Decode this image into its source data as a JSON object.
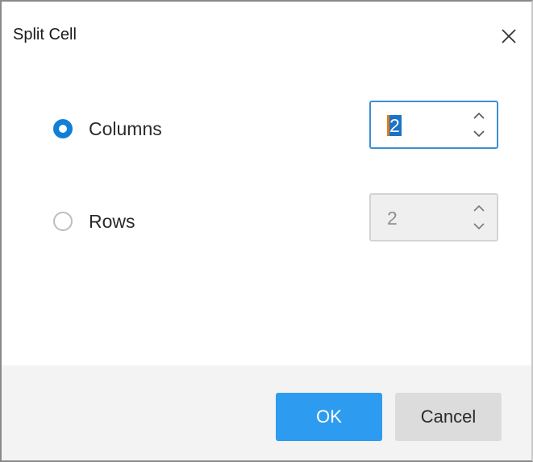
{
  "dialog": {
    "title": "Split Cell",
    "close_icon": "close-icon"
  },
  "options": {
    "columns": {
      "label": "Columns",
      "checked": true,
      "value": "2"
    },
    "rows": {
      "label": "Rows",
      "checked": false,
      "value": "2"
    }
  },
  "spinner_icons": {
    "up": "chevron-up-icon",
    "down": "chevron-down-icon"
  },
  "footer": {
    "ok_label": "OK",
    "cancel_label": "Cancel"
  },
  "colors": {
    "accent": "#0f7fd8",
    "ok_button": "#2d9cf0",
    "cancel_button": "#dcdcdc",
    "footer_bg": "#f3f3f3",
    "disabled_bg": "#efefef"
  }
}
